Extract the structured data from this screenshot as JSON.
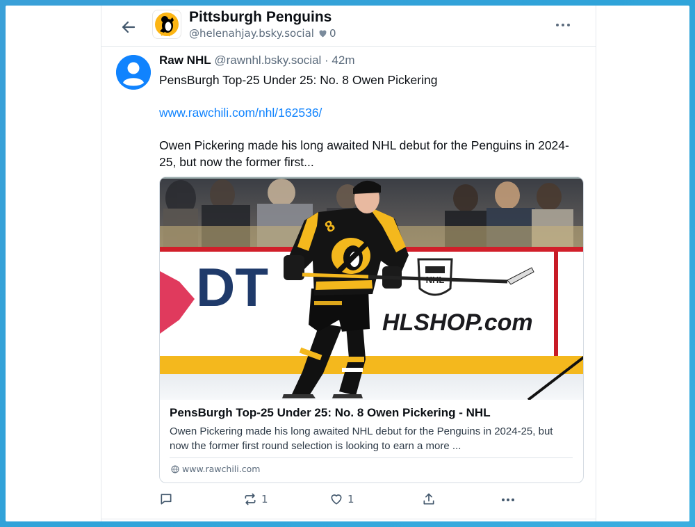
{
  "feed": {
    "title": "Pittsburgh Penguins",
    "handle": "@helenahjay.bsky.social",
    "likes": "0"
  },
  "post": {
    "author_name": "Raw NHL",
    "author_handle": "@rawnhl.bsky.social",
    "separator": " · ",
    "time": "42m",
    "line1": "PensBurgh Top-25 Under 25: No. 8 Owen Pickering",
    "link": "www.rawchili.com/nhl/162536/",
    "body": "Owen Pickering made his long awaited NHL debut for the Penguins in 2024-25, but now the former first..."
  },
  "card": {
    "image_signage": {
      "left": "DT",
      "right": "HLSHOP.com",
      "jersey_number": "8"
    },
    "title": "PensBurgh Top-25 Under 25: No. 8 Owen Pickering - NHL",
    "description": "Owen Pickering made his long awaited NHL debut for the Penguins in 2024-25, but now the former first round selection is looking to earn a more ...",
    "domain": "www.rawchili.com"
  },
  "actions": {
    "reply_count": "",
    "repost_count": "1",
    "like_count": "1"
  },
  "colors": {
    "accent": "#1083fe",
    "text": "#0b0f14",
    "muted": "#5b6b7c",
    "penguins_gold": "#fcb514"
  },
  "icons": [
    "back-arrow-icon",
    "heart-icon",
    "more-icon",
    "reply-icon",
    "repost-icon",
    "share-icon",
    "globe-icon",
    "default-avatar-icon"
  ]
}
